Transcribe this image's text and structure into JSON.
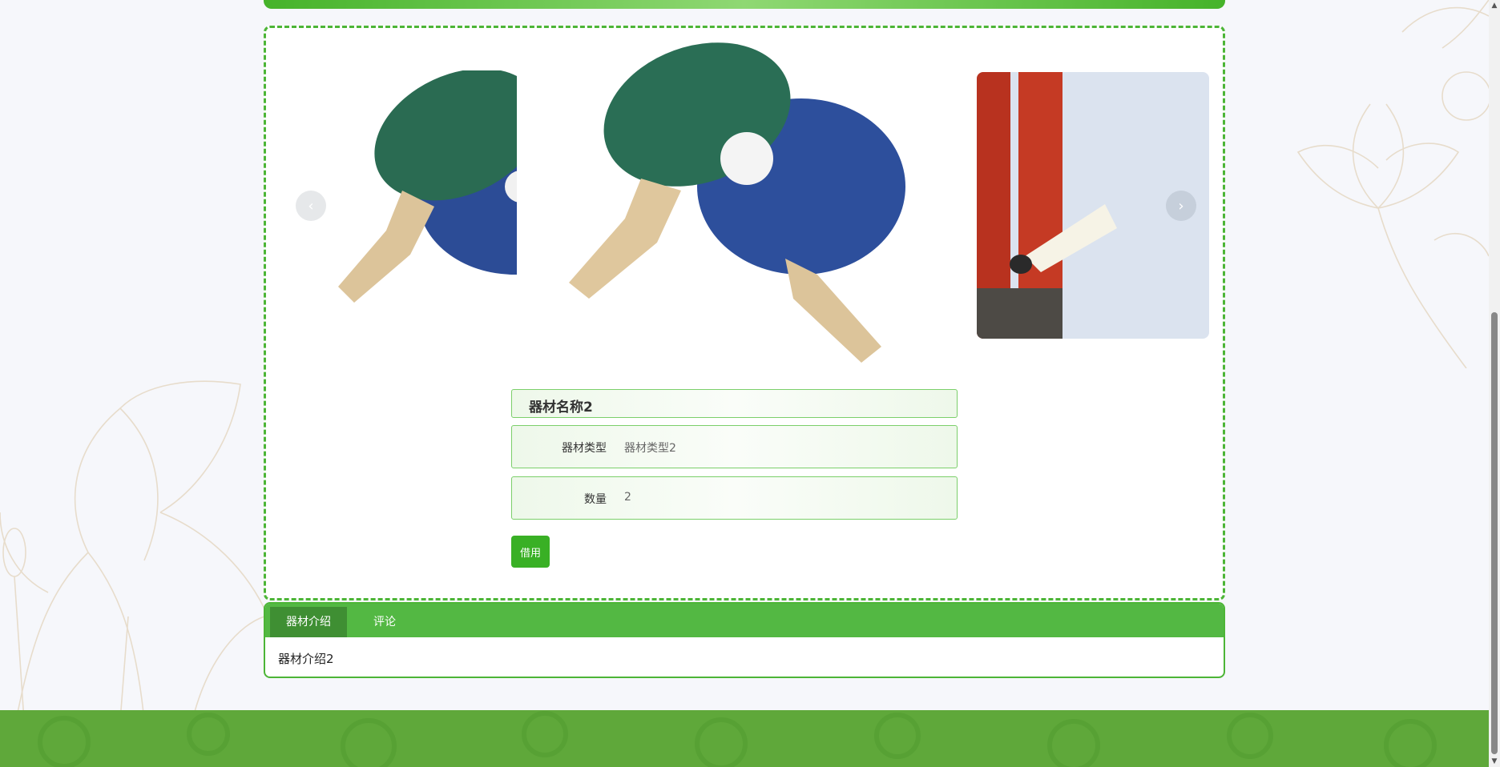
{
  "product": {
    "name": "器材名称2",
    "type_label": "器材类型",
    "type_value": "器材类型2",
    "quantity_label": "数量",
    "quantity_value": "2",
    "borrow_label": "借用"
  },
  "carousel": {
    "prev_icon": "‹",
    "next_icon": "›",
    "images": [
      "table-tennis-paddles",
      "table-tennis-paddles",
      "badminton-shuttlecock-tubes"
    ]
  },
  "tabs": {
    "items": [
      {
        "label": "器材介绍",
        "active": true
      },
      {
        "label": "评论",
        "active": false
      }
    ],
    "content": "器材介绍2"
  },
  "scrollbar": {
    "up_icon": "▲",
    "down_icon": "▼"
  },
  "colors": {
    "accent": "#4cb536",
    "button": "#39b025",
    "tab_active": "#3f8f33",
    "footer": "#5fa83a"
  }
}
